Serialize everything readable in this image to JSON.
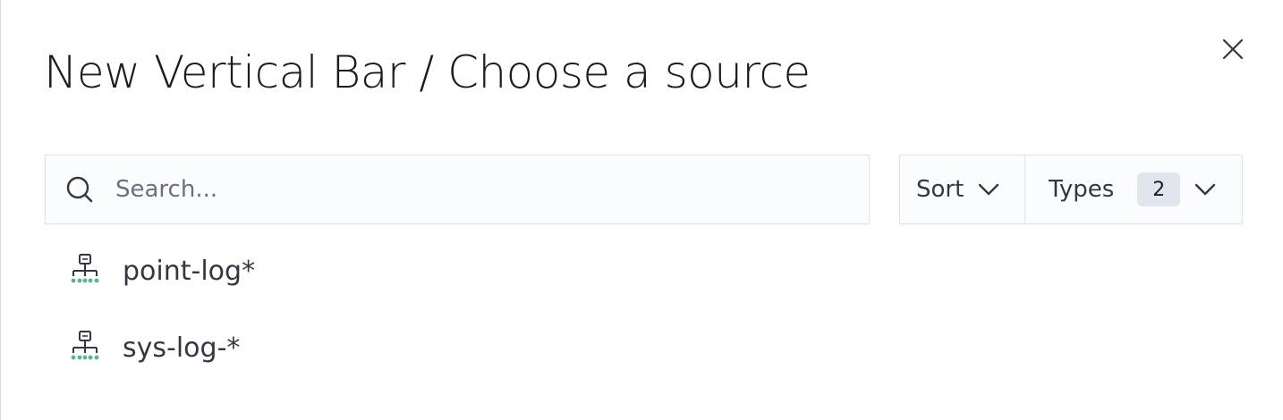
{
  "modal": {
    "title": "New Vertical Bar / Choose a source",
    "close_icon": "close-icon"
  },
  "search": {
    "placeholder": "Search...",
    "value": "",
    "icon": "search-icon"
  },
  "filters": {
    "sort_label": "Sort",
    "types_label": "Types",
    "types_count": "2",
    "dropdown_icon": "chevron-down-icon"
  },
  "sources": [
    {
      "label": "point-log*",
      "icon": "index-pattern-icon"
    },
    {
      "label": "sys-log-*",
      "icon": "index-pattern-icon"
    }
  ],
  "colors": {
    "title": "#1a1c21",
    "text": "#343741",
    "border": "#dde3ec",
    "field_bg": "#fbfcfd",
    "badge_bg": "#e0e5ee",
    "icon_accent": "#54b399"
  }
}
